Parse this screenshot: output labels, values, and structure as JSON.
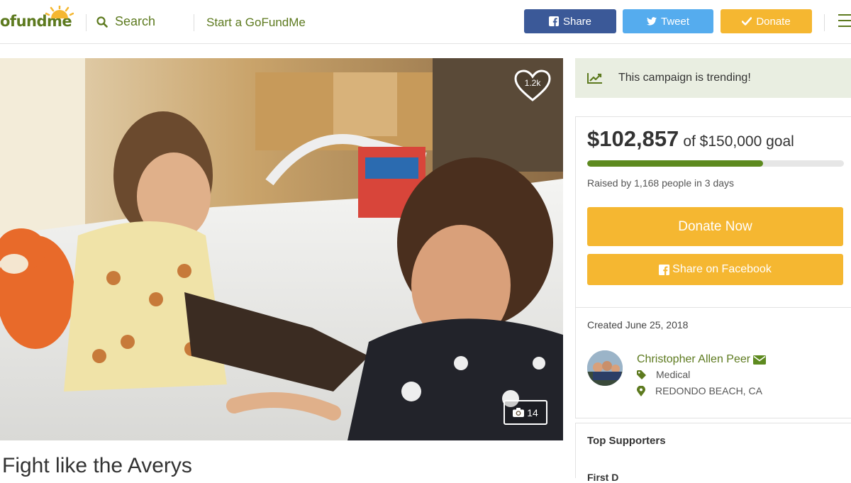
{
  "header": {
    "logo_text": "ofundme",
    "search_label": "Search",
    "start_label": "Start a GoFundMe",
    "share_label": "Share",
    "tweet_label": "Tweet",
    "donate_label": "Donate"
  },
  "campaign": {
    "title": "Fight like the Averys",
    "likes": "1.2k",
    "photo_count": "14"
  },
  "sidebar": {
    "trending_text": "This campaign is trending!",
    "raised": "$102,857",
    "goal_text": "of $150,000 goal",
    "progress_fraction": 0.6857,
    "raised_by": "Raised by 1,168 people in 3 days",
    "donate_now_label": "Donate Now",
    "share_fb_label": "Share on Facebook",
    "created": "Created June 25, 2018",
    "organizer": "Christopher Allen Peer",
    "category": "Medical",
    "location": "REDONDO BEACH, CA",
    "top_supporters": "Top Supporters",
    "next_section_partial": "First D"
  },
  "colors": {
    "brand_green": "#5d7a1f",
    "facebook_blue": "#3b5998",
    "twitter_blue": "#55acee",
    "donate_yellow": "#f5b731",
    "trending_bg": "#e9eee1"
  }
}
